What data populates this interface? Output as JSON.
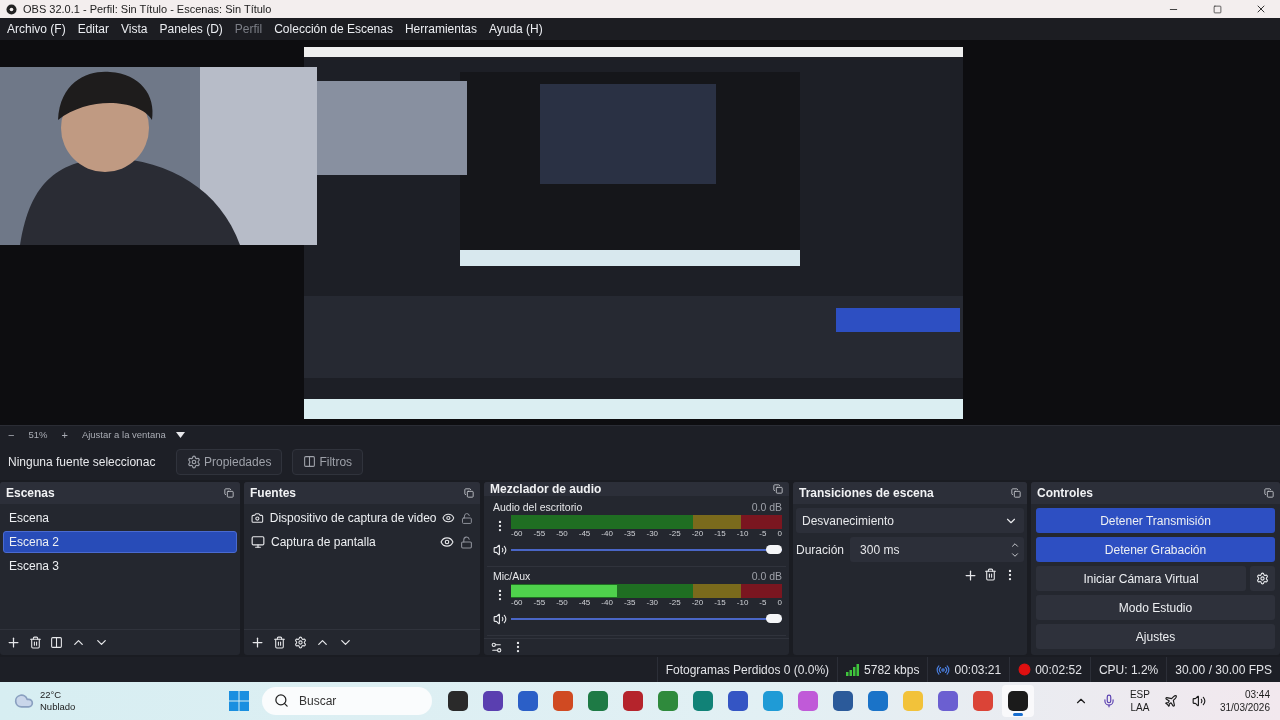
{
  "window": {
    "title": "OBS 32.0.1 - Perfil: Sin Título - Escenas: Sin Título"
  },
  "menu": [
    {
      "label": "Archivo (F)",
      "disabled": false
    },
    {
      "label": "Editar",
      "disabled": false
    },
    {
      "label": "Vista",
      "disabled": false
    },
    {
      "label": "Paneles (D)",
      "disabled": false
    },
    {
      "label": "Perfil",
      "disabled": true
    },
    {
      "label": "Colección de Escenas",
      "disabled": false
    },
    {
      "label": "Herramientas",
      "disabled": false
    },
    {
      "label": "Ayuda (H)",
      "disabled": false
    }
  ],
  "preview": {
    "kind": "picture",
    "zoom_out": "−",
    "zoom": "51%",
    "zoom_in": "+",
    "fit": "Ajustar a la ventana"
  },
  "context_bar": {
    "source": "Ninguna fuente seleccionac",
    "properties": "Propiedades",
    "filters": "Filtros"
  },
  "scenes": {
    "title": "Escenas",
    "items": [
      {
        "label": "Escena",
        "selected": false
      },
      {
        "label": "Escena 2",
        "selected": true
      },
      {
        "label": "Escena 3",
        "selected": false
      }
    ]
  },
  "sources": {
    "title": "Fuentes",
    "items": [
      {
        "label": "Dispositivo de captura de video",
        "kind": "camera",
        "visible": true,
        "locked": false
      },
      {
        "label": "Captura de pantalla",
        "kind": "display",
        "visible": true,
        "locked": false
      }
    ]
  },
  "mixer": {
    "title": "Mezclador de audio",
    "channels": [
      {
        "name": "Audio del escritorio",
        "reading": "0.0 dB",
        "meter": {
          "level": 0
        },
        "volume": {
          "level": 1
        },
        "ticks": [
          "-60",
          "-55",
          "-50",
          "-45",
          "-40",
          "-35",
          "-30",
          "-25",
          "-20",
          "-15",
          "-10",
          "-5",
          "0"
        ]
      },
      {
        "name": "Mic/Aux",
        "reading": "0.0 dB",
        "meter": {
          "level": 0.39
        },
        "volume": {
          "level": 1
        },
        "ticks": [
          "-60",
          "-55",
          "-50",
          "-45",
          "-40",
          "-35",
          "-30",
          "-25",
          "-20",
          "-15",
          "-10",
          "-5",
          "0"
        ]
      }
    ]
  },
  "transitions": {
    "title": "Transiciones de escena",
    "transition": "Desvanecimiento",
    "duration_label": "Duración",
    "duration": "300 ms"
  },
  "controls": {
    "title": "Controles",
    "buttons": [
      {
        "label": "Detener Transmisión",
        "active": true,
        "kind": "plain"
      },
      {
        "label": "Detener Grabación",
        "active": true,
        "kind": "plain"
      },
      {
        "label": "Iniciar Cámara Virtual",
        "active": false,
        "kind": "with-settings"
      },
      {
        "label": "Modo Estudio",
        "active": false,
        "kind": "plain"
      },
      {
        "label": "Ajustes",
        "active": false,
        "kind": "plain"
      }
    ]
  },
  "status_bar": {
    "dropped": "Fotogramas Perdidos 0 (0.0%)",
    "bitrate": "5782 kbps",
    "stream_time": "00:03:21",
    "record_time": "00:02:52",
    "cpu": "CPU: 1.2%",
    "fps": "30.00 / 30.00 FPS"
  },
  "taskbar": {
    "temperature": "22°C",
    "weather": "Nublado",
    "search": {
      "placeholder": "Buscar"
    },
    "apps": [
      {
        "color": "#2a2a2a",
        "selected": false
      },
      {
        "color": "#5a3fb0",
        "selected": false
      },
      {
        "color": "#2b5fc7",
        "selected": false
      },
      {
        "color": "#d04a22",
        "selected": false
      },
      {
        "color": "#1e7a45",
        "selected": false
      },
      {
        "color": "#b5242c",
        "selected": false
      },
      {
        "color": "#2f8a3c",
        "selected": false
      },
      {
        "color": "#118277",
        "selected": false
      },
      {
        "color": "#3455c4",
        "selected": false
      },
      {
        "color": "#1f9bd6",
        "selected": false
      },
      {
        "color": "#c05ad8",
        "selected": false
      },
      {
        "color": "#2b5a9a",
        "selected": false
      },
      {
        "color": "#1a73c8",
        "selected": false
      },
      {
        "color": "#f2c23a",
        "selected": false
      },
      {
        "color": "#6b5fd1",
        "selected": false
      },
      {
        "color": "#db4437",
        "selected": false
      },
      {
        "color": "#1b1b1b",
        "selected": true
      }
    ],
    "language": "ESP",
    "region": "LAA",
    "time": "03:44",
    "date": "31/03/2026"
  }
}
